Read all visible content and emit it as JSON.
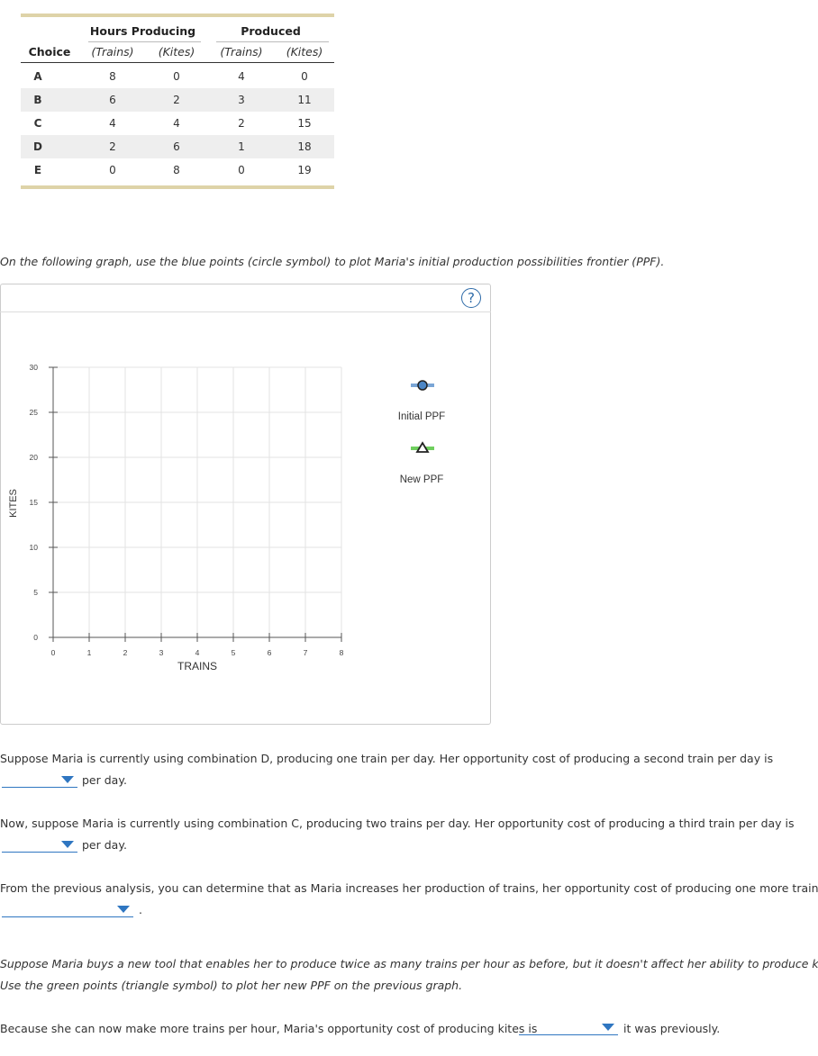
{
  "table": {
    "group_headers": {
      "hours": "Hours Producing",
      "produced": "Produced"
    },
    "col_headers": [
      "Choice",
      "(Trains)",
      "(Kites)",
      "(Trains)",
      "(Kites)"
    ],
    "rows": [
      {
        "choice": "A",
        "h_trains": "8",
        "h_kites": "0",
        "p_trains": "4",
        "p_kites": "0"
      },
      {
        "choice": "B",
        "h_trains": "6",
        "h_kites": "2",
        "p_trains": "3",
        "p_kites": "11"
      },
      {
        "choice": "C",
        "h_trains": "4",
        "h_kites": "4",
        "p_trains": "2",
        "p_kites": "15"
      },
      {
        "choice": "D",
        "h_trains": "2",
        "h_kites": "6",
        "p_trains": "1",
        "p_kites": "18"
      },
      {
        "choice": "E",
        "h_trains": "0",
        "h_kites": "8",
        "p_trains": "0",
        "p_kites": "19"
      }
    ]
  },
  "instruction_1": "On the following graph, use the blue points (circle symbol) to plot Maria's initial production possibilities frontier (PPF).",
  "graph": {
    "help_label": "?",
    "legend": {
      "initial": {
        "label": "Initial PPF",
        "color": "#6b9fd4",
        "symbol": "circle"
      },
      "new": {
        "label": "New PPF",
        "color": "#5fc35a",
        "symbol": "triangle"
      }
    }
  },
  "chart_data": {
    "type": "scatter",
    "xlabel": "TRAINS",
    "ylabel": "KITES",
    "xlim": [
      0,
      8
    ],
    "ylim": [
      0,
      30
    ],
    "x_ticks": [
      "0",
      "1",
      "2",
      "3",
      "4",
      "5",
      "6",
      "7",
      "8"
    ],
    "y_ticks": [
      "0",
      "5",
      "10",
      "15",
      "20",
      "25",
      "30"
    ],
    "grid": true,
    "series": []
  },
  "questions": {
    "q1_text": "Suppose Maria is currently using combination D, producing one train per day. Her opportunity cost of producing a second train per day is",
    "q1_suffix": "per day.",
    "q2_text": "Now, suppose Maria is currently using combination C, producing two trains per day. Her opportunity cost of producing a third train per day is",
    "q2_suffix": "per day.",
    "q3_text": "From the previous analysis, you can determine that as Maria increases her production of trains, her opportunity cost of producing one more train",
    "q3_suffix": ".",
    "instruction_2_line1": "Suppose Maria buys a new tool that enables her to produce twice as many trains per hour as before, but it doesn't affect her ability to produce kites.",
    "instruction_2_line2": "Use the green points (triangle symbol) to plot her new PPF on the previous graph.",
    "q4_text": "Because she can now make more trains per hour, Maria's opportunity cost of producing kites is",
    "q4_suffix": "it was previously."
  }
}
